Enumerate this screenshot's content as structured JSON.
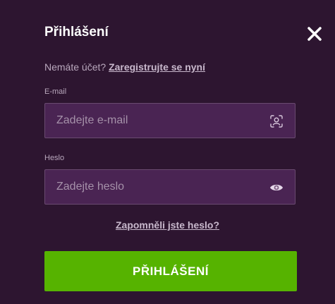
{
  "dialog": {
    "title": "Přihlášení",
    "close_icon": "close-icon"
  },
  "register": {
    "prompt": "Nemáte účet?",
    "link_text": "Zaregistrujte se nyní"
  },
  "email": {
    "label": "E-mail",
    "placeholder": "Zadejte e-mail",
    "value": "",
    "icon": "user-scan-icon"
  },
  "password": {
    "label": "Heslo",
    "placeholder": "Zadejte heslo",
    "value": "",
    "icon": "eye-icon"
  },
  "forgot": {
    "link_text": "Zapomněli jste heslo?"
  },
  "submit": {
    "label": "PŘIHLÁŠENÍ"
  },
  "colors": {
    "background": "#2d1530",
    "input_background": "#4a2453",
    "accent": "#56b300"
  }
}
